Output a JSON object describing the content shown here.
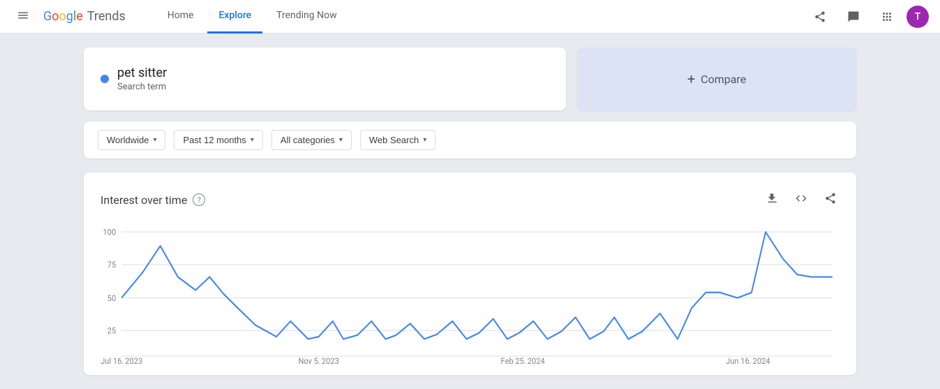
{
  "header": {
    "menu_icon": "☰",
    "logo": {
      "google": "Google",
      "trends": "Trends"
    },
    "nav": [
      {
        "label": "Home",
        "active": false
      },
      {
        "label": "Explore",
        "active": true
      },
      {
        "label": "Trending Now",
        "active": false
      }
    ],
    "icons": {
      "share": "share",
      "feedback": "feedback",
      "apps": "apps"
    },
    "avatar_letter": "T"
  },
  "search": {
    "term": "pet sitter",
    "term_type": "Search term",
    "dot_color": "#4285f4",
    "compare_label": "Compare",
    "compare_plus": "+"
  },
  "filters": [
    {
      "label": "Worldwide",
      "id": "region"
    },
    {
      "label": "Past 12 months",
      "id": "time"
    },
    {
      "label": "All categories",
      "id": "category"
    },
    {
      "label": "Web Search",
      "id": "search-type"
    }
  ],
  "chart": {
    "title": "Interest over time",
    "help_label": "?",
    "y_labels": [
      "100",
      "75",
      "50",
      "25"
    ],
    "x_labels": [
      "Jul 16, 2023",
      "Nov 5, 2023",
      "Feb 25, 2024",
      "Jun 16, 2024"
    ],
    "grid_color": "#e0e0e0",
    "line_color": "#4285f4",
    "actions": {
      "download": "⬇",
      "embed": "<>",
      "share": "share"
    }
  }
}
